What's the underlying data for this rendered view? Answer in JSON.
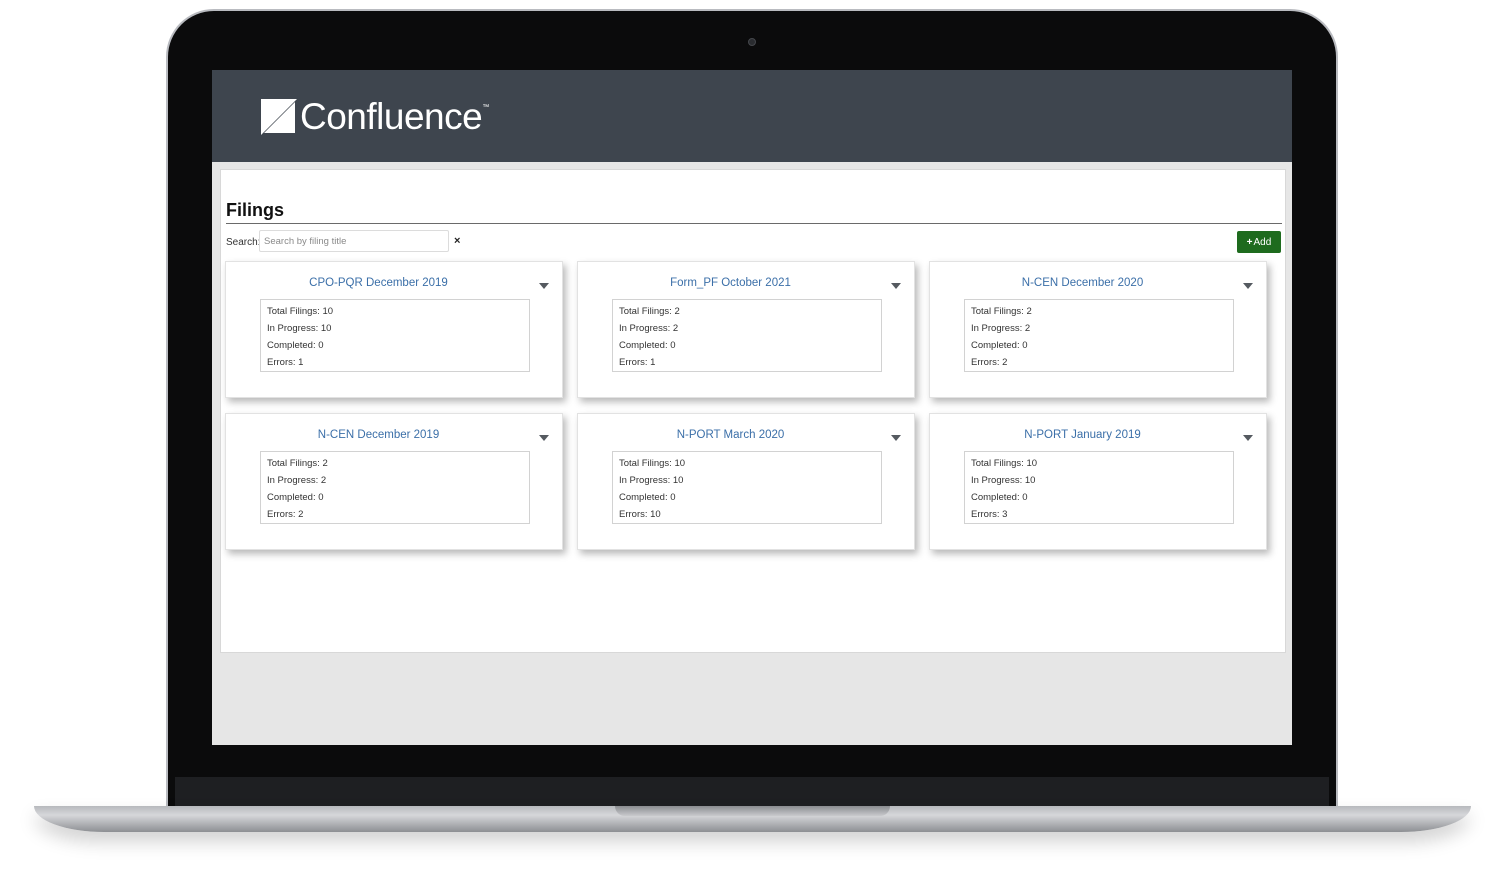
{
  "app": {
    "logo_text": "Confluence",
    "logo_tm": "™",
    "header_color": "#3e454e"
  },
  "page": {
    "title": "Filings",
    "search": {
      "label": "Search:",
      "placeholder": "Search by filing title",
      "value": "",
      "clear_icon": "close-icon",
      "clear_glyph": "×"
    },
    "add_button": {
      "icon": "plus-icon",
      "icon_glyph": "+",
      "label": "Add",
      "color": "#1e6b1e"
    }
  },
  "stat_labels": {
    "total": "Total Filings:",
    "in_progress": "In Progress:",
    "completed": "Completed:",
    "errors": "Errors:"
  },
  "filings": [
    {
      "title": "CPO-PQR December 2019",
      "total": "10",
      "in_progress": "10",
      "completed": "0",
      "errors": "1"
    },
    {
      "title": "Form_PF October 2021",
      "total": "2",
      "in_progress": "2",
      "completed": "0",
      "errors": "1"
    },
    {
      "title": "N-CEN December 2020",
      "total": "2",
      "in_progress": "2",
      "completed": "0",
      "errors": "2"
    },
    {
      "title": "N-CEN December 2019",
      "total": "2",
      "in_progress": "2",
      "completed": "0",
      "errors": "2"
    },
    {
      "title": "N-PORT March 2020",
      "total": "10",
      "in_progress": "10",
      "completed": "0",
      "errors": "10"
    },
    {
      "title": "N-PORT January 2019",
      "total": "10",
      "in_progress": "10",
      "completed": "0",
      "errors": "3"
    }
  ],
  "colors": {
    "link": "#3b6fa8",
    "accent": "#1e6b1e"
  }
}
